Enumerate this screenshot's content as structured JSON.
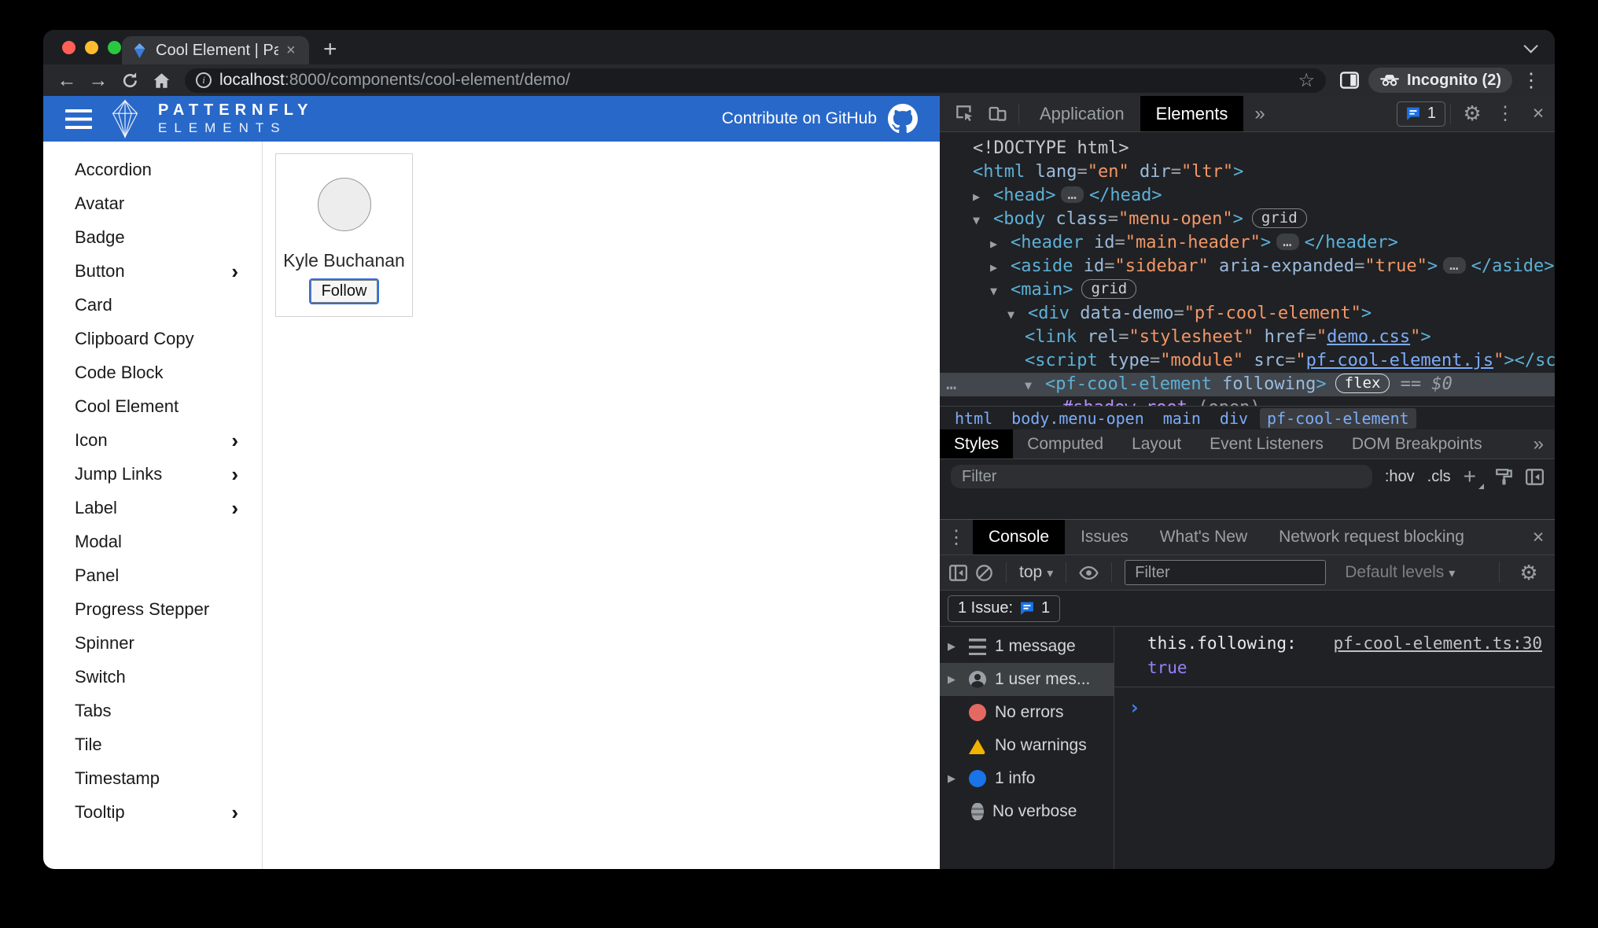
{
  "colors": {
    "brand_blue": "#2868c9",
    "devtools_bg": "#202124",
    "devtools_toolbar": "#292a2d",
    "active_tab": "#000000",
    "tag": "#5db0d7",
    "attr_name": "#9bbbdc",
    "attr_value": "#f29766",
    "link": "#7cacf8",
    "selection": "#42474d",
    "error_red": "#e46962",
    "warning_yellow": "#f0b400",
    "info_blue": "#1a73e8",
    "console_true": "#9980ff"
  },
  "icons": {
    "close": "×",
    "new_tab": "+",
    "back": "←",
    "forward": "→",
    "star": "☆",
    "kebab": "⋮",
    "gear": "⚙",
    "more_tabs": "»",
    "dropdown": "▾",
    "chevron_right": "›",
    "prompt": "›",
    "collapsed": "▶",
    "info_i": "i"
  },
  "browser": {
    "tab": {
      "title": "Cool Element | PatternFly Elem"
    },
    "url": {
      "host": "localhost",
      "rest": ":8000/components/cool-element/demo/"
    },
    "incognito_label": "Incognito (2)"
  },
  "page": {
    "header": {
      "brand_top": "PATTERNFLY",
      "brand_bottom": "ELEMENTS",
      "contribute_label": "Contribute on GitHub"
    },
    "sidebar": {
      "items": [
        {
          "label": "Accordion"
        },
        {
          "label": "Avatar"
        },
        {
          "label": "Badge"
        },
        {
          "label": "Button",
          "expandable": true
        },
        {
          "label": "Card"
        },
        {
          "label": "Clipboard Copy"
        },
        {
          "label": "Code Block"
        },
        {
          "label": "Cool Element"
        },
        {
          "label": "Icon",
          "expandable": true
        },
        {
          "label": "Jump Links",
          "expandable": true
        },
        {
          "label": "Label",
          "expandable": true
        },
        {
          "label": "Modal"
        },
        {
          "label": "Panel"
        },
        {
          "label": "Progress Stepper"
        },
        {
          "label": "Spinner"
        },
        {
          "label": "Switch"
        },
        {
          "label": "Tabs"
        },
        {
          "label": "Tile"
        },
        {
          "label": "Timestamp"
        },
        {
          "label": "Tooltip",
          "expandable": true
        }
      ]
    },
    "demo_card": {
      "name": "Kyle Buchanan",
      "follow_label": "Follow"
    }
  },
  "devtools": {
    "main_tabs": {
      "items": [
        {
          "label": "Application"
        },
        {
          "label": "Elements",
          "active": true
        }
      ],
      "issue_count": "1"
    },
    "dom_tree": {
      "lines": [
        {
          "indent": 0,
          "arrow": null,
          "tokens": [
            [
              "doctype",
              "<!DOCTYPE html>"
            ]
          ]
        },
        {
          "indent": 0,
          "arrow": null,
          "tokens": [
            [
              "tag",
              "<html"
            ],
            [
              "attr",
              " lang"
            ],
            [
              "punc",
              "="
            ],
            [
              "val",
              "\"en\""
            ],
            [
              "attr",
              " dir"
            ],
            [
              "punc",
              "="
            ],
            [
              "val",
              "\"ltr\""
            ],
            [
              "tag",
              ">"
            ]
          ]
        },
        {
          "indent": 0,
          "arrow": "▶",
          "tokens": [
            [
              "tag",
              "<head>"
            ],
            [
              "more",
              "…"
            ],
            [
              "tag",
              "</head>"
            ]
          ]
        },
        {
          "indent": 0,
          "arrow": "▼",
          "tokens": [
            [
              "tag",
              "<body"
            ],
            [
              "attr",
              " class"
            ],
            [
              "punc",
              "="
            ],
            [
              "val",
              "\"menu-open\""
            ],
            [
              "tag",
              ">"
            ],
            [
              "badge",
              "grid"
            ]
          ]
        },
        {
          "indent": 1,
          "arrow": "▶",
          "tokens": [
            [
              "tag",
              "<header"
            ],
            [
              "attr",
              " id"
            ],
            [
              "punc",
              "="
            ],
            [
              "val",
              "\"main-header\""
            ],
            [
              "tag",
              ">"
            ],
            [
              "more",
              "…"
            ],
            [
              "tag",
              "</header>"
            ]
          ]
        },
        {
          "indent": 1,
          "arrow": "▶",
          "tokens": [
            [
              "tag",
              "<aside"
            ],
            [
              "attr",
              " id"
            ],
            [
              "punc",
              "="
            ],
            [
              "val",
              "\"sidebar\""
            ],
            [
              "attr",
              " aria-expanded"
            ],
            [
              "punc",
              "="
            ],
            [
              "val",
              "\"true\""
            ],
            [
              "tag",
              ">"
            ],
            [
              "more",
              "…"
            ],
            [
              "tag",
              "</aside>"
            ]
          ]
        },
        {
          "indent": 1,
          "arrow": "▼",
          "tokens": [
            [
              "tag",
              "<main>"
            ],
            [
              "badge",
              "grid"
            ]
          ]
        },
        {
          "indent": 2,
          "arrow": "▼",
          "tokens": [
            [
              "tag",
              "<div"
            ],
            [
              "attr",
              " data-demo"
            ],
            [
              "punc",
              "="
            ],
            [
              "val",
              "\"pf-cool-element\""
            ],
            [
              "tag",
              ">"
            ]
          ]
        },
        {
          "indent": 3,
          "arrow": null,
          "tokens": [
            [
              "tag",
              "<link"
            ],
            [
              "attr",
              " rel"
            ],
            [
              "punc",
              "="
            ],
            [
              "val",
              "\"stylesheet\""
            ],
            [
              "attr",
              " href"
            ],
            [
              "punc",
              "="
            ],
            [
              "val",
              "\""
            ],
            [
              "link",
              "demo.css"
            ],
            [
              "val",
              "\""
            ],
            [
              "tag",
              ">"
            ]
          ]
        },
        {
          "indent": 3,
          "arrow": null,
          "tokens": [
            [
              "tag",
              "<script"
            ],
            [
              "attr",
              " type"
            ],
            [
              "punc",
              "="
            ],
            [
              "val",
              "\"module\""
            ],
            [
              "attr",
              " src"
            ],
            [
              "punc",
              "="
            ],
            [
              "val",
              "\""
            ],
            [
              "link",
              "pf-cool-element.js"
            ],
            [
              "val",
              "\""
            ],
            [
              "tag",
              ">"
            ],
            [
              "tag",
              "</script>"
            ]
          ]
        },
        {
          "indent": 3,
          "arrow": "▼",
          "selected": true,
          "gutter": "…",
          "tokens": [
            [
              "tag",
              "<pf-cool-element"
            ],
            [
              "attr",
              " following"
            ],
            [
              "tag",
              ">"
            ],
            [
              "badgeb",
              "flex"
            ],
            [
              "eq",
              "  == "
            ],
            [
              "dollar",
              "$0"
            ]
          ]
        },
        {
          "indent": 4,
          "arrow": "▶",
          "clipped": true,
          "tokens": [
            [
              "shadow",
              "#shadow-root"
            ],
            [
              "paren",
              " (open)"
            ]
          ]
        }
      ]
    },
    "breadcrumbs": {
      "items": [
        {
          "label": "html"
        },
        {
          "label": "body.menu-open"
        },
        {
          "label": "main"
        },
        {
          "label": "div"
        },
        {
          "label": "pf-cool-element",
          "active": true
        }
      ]
    },
    "styles_tabs": {
      "items": [
        {
          "label": "Styles",
          "active": true
        },
        {
          "label": "Computed"
        },
        {
          "label": "Layout"
        },
        {
          "label": "Event Listeners"
        },
        {
          "label": "DOM Breakpoints"
        }
      ]
    },
    "styles_filter": {
      "placeholder": "Filter",
      "pseudo": ":hov",
      "classes": ".cls"
    },
    "console": {
      "tabs": {
        "items": [
          {
            "label": "Console",
            "active": true
          },
          {
            "label": "Issues"
          },
          {
            "label": "What's New"
          },
          {
            "label": "Network request blocking"
          }
        ]
      },
      "toolbar": {
        "context": "top",
        "filter_placeholder": "Filter",
        "levels": "Default levels"
      },
      "issues_bar": {
        "label": "1 Issue:",
        "count": "1"
      },
      "sidebar": {
        "items": [
          {
            "icon": "list",
            "label": "1 message",
            "expandable": true
          },
          {
            "icon": "user",
            "label": "1 user mes...",
            "expandable": true,
            "selected": true
          },
          {
            "icon": "error",
            "label": "No errors"
          },
          {
            "icon": "warning",
            "label": "No warnings"
          },
          {
            "icon": "info",
            "label": "1 info",
            "expandable": true
          },
          {
            "icon": "verbose",
            "label": "No verbose"
          }
        ]
      },
      "log": {
        "text": "this.following:",
        "value": "true",
        "source_link": "pf-cool-element.ts:30"
      }
    }
  }
}
